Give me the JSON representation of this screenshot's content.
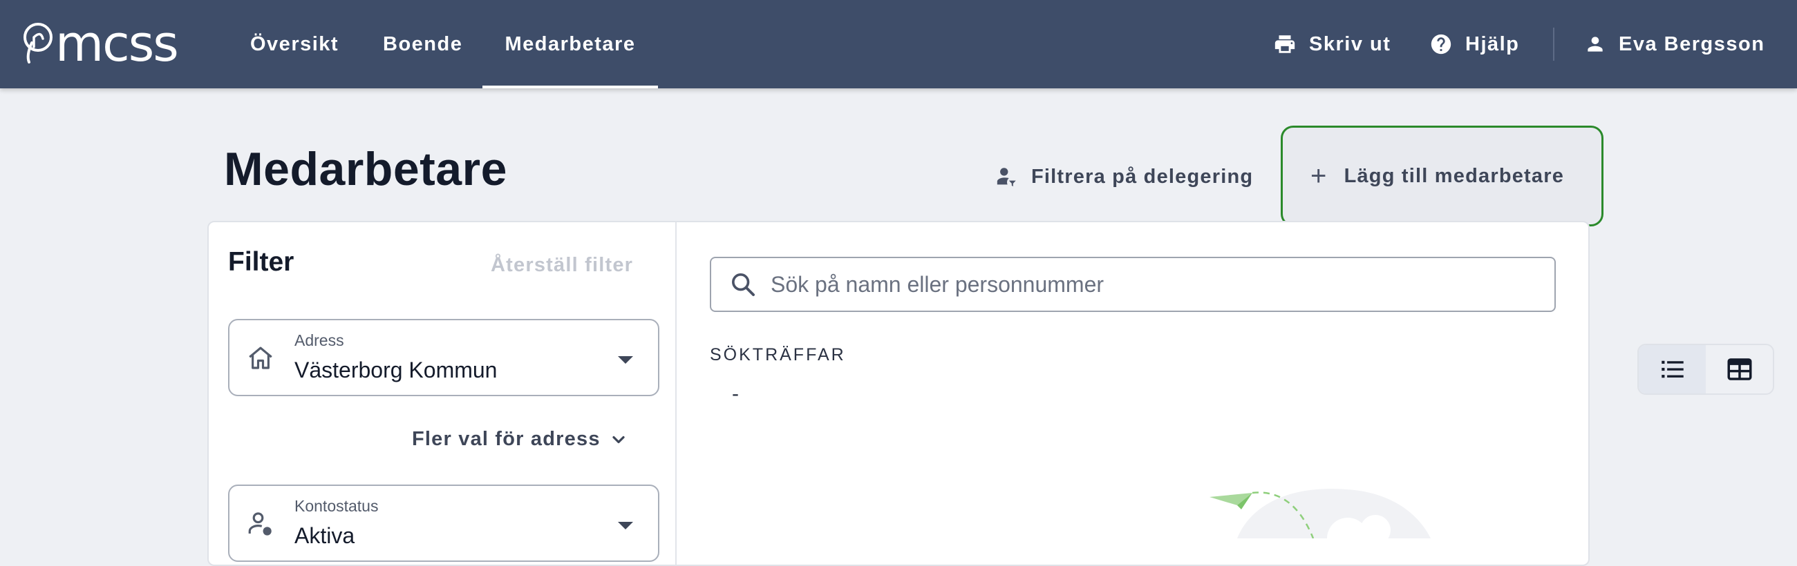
{
  "app": {
    "logo_text": "mcss"
  },
  "nav": {
    "items": [
      {
        "label": "Översikt"
      },
      {
        "label": "Boende"
      },
      {
        "label": "Medarbetare",
        "active": true
      }
    ]
  },
  "top_actions": {
    "print": "Skriv ut",
    "help": "Hjälp",
    "user": "Eva Bergsson"
  },
  "page": {
    "title": "Medarbetare",
    "filter_delegation": "Filtrera på delegering",
    "add_employee": "Lägg till medarbetare"
  },
  "filter": {
    "title": "Filter",
    "reset": "Återställ filter",
    "address": {
      "label": "Adress",
      "value": "Västerborg Kommun"
    },
    "more_address": "Fler val för adress",
    "account_status": {
      "label": "Kontostatus",
      "value": "Aktiva"
    }
  },
  "results": {
    "search_placeholder": "Sök på namn eller personnummer",
    "search_value": "",
    "hits_label": "SÖKTRÄFFAR",
    "hits_value": "-",
    "view_mode": "list"
  },
  "colors": {
    "topbar": "#3e4d69",
    "add_button_border": "#2b8a2b",
    "page_background": "#eef0f4"
  }
}
